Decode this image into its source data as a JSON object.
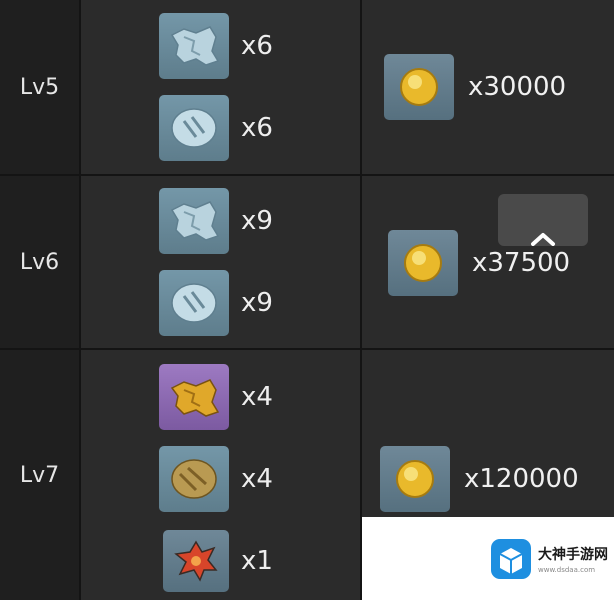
{
  "rows": [
    {
      "level": "Lv5",
      "materials": [
        {
          "icon": "blue-horn-fragment-icon",
          "quantity": "x6"
        },
        {
          "icon": "blue-crystal-stone-icon",
          "quantity": "x6"
        }
      ],
      "cost": {
        "icon": "gold-coin-icon",
        "quantity": "x30000"
      }
    },
    {
      "level": "Lv6",
      "materials": [
        {
          "icon": "blue-horn-fragment-icon",
          "quantity": "x9"
        },
        {
          "icon": "blue-crystal-stone-icon",
          "quantity": "x9"
        }
      ],
      "cost": {
        "icon": "gold-coin-icon",
        "quantity": "x37500"
      }
    },
    {
      "level": "Lv7",
      "materials": [
        {
          "icon": "gold-horn-fragment-icon",
          "quantity": "x4"
        },
        {
          "icon": "gold-engraved-stone-icon",
          "quantity": "x4"
        },
        {
          "icon": "red-core-icon",
          "quantity": "x1"
        }
      ],
      "cost": {
        "icon": "gold-coin-icon",
        "quantity": "x120000"
      }
    }
  ],
  "scroll_top_button": {
    "icon": "chevron-up-icon"
  },
  "watermark": {
    "title": "大神手游网",
    "url": "www.dsdaa.com"
  },
  "colors": {
    "background": "#141414",
    "cell": "#2b2b2b",
    "level_cell": "#1f1f1f",
    "blue_tile": "#6a8fa0",
    "purple_tile": "#8c68b3"
  }
}
